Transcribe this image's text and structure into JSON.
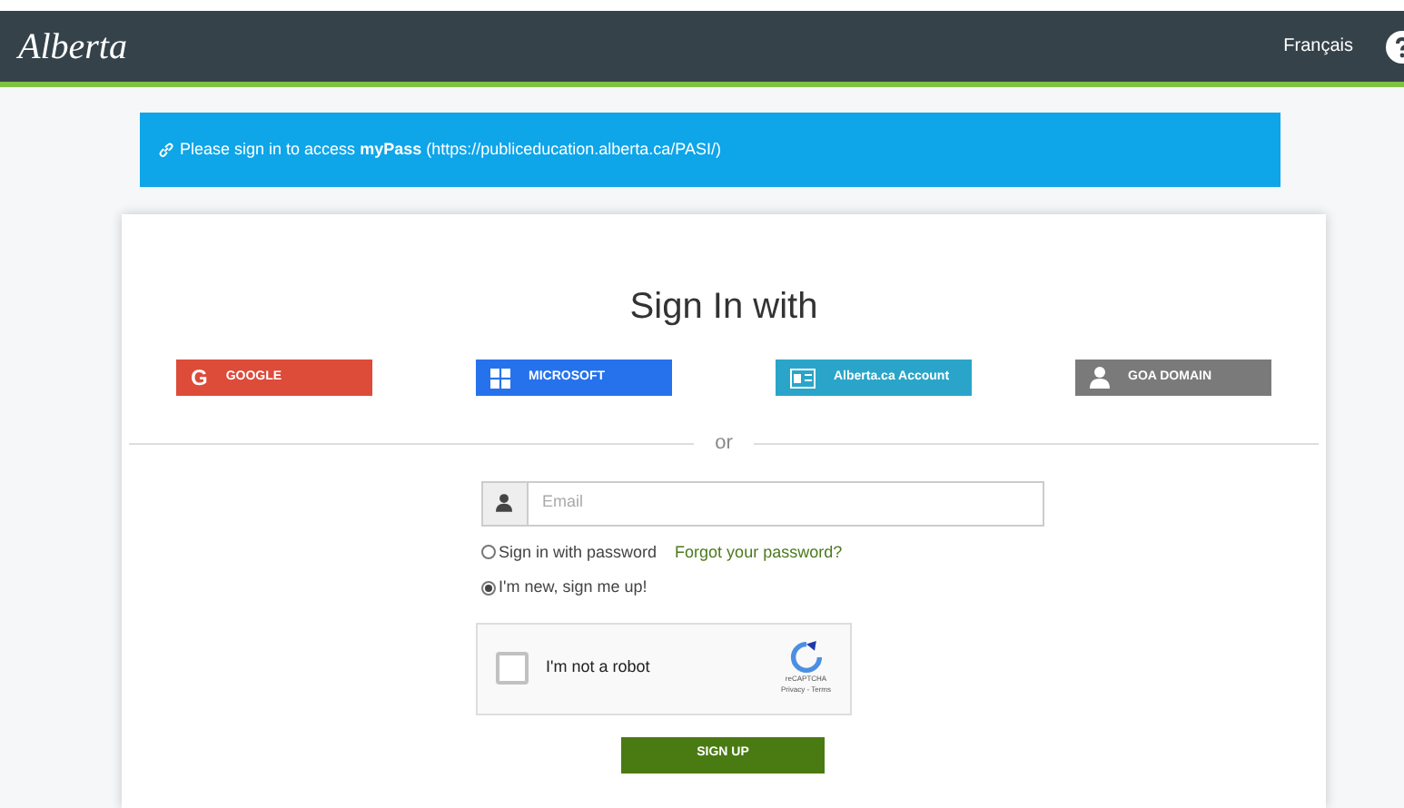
{
  "header": {
    "logo": "Alberta",
    "language_link": "Français"
  },
  "banner": {
    "text": "Please sign in to access **myPass** (https://publiceducation.alberta.ca/PASI/)"
  },
  "card": {
    "title": "Sign In with",
    "providers": [
      {
        "kind": "google",
        "icon": "G",
        "label": "GOOGLE",
        "color": "#dd4b39"
      },
      {
        "kind": "microsoft",
        "label": "MICROSOFT",
        "color": "#2672ec"
      },
      {
        "kind": "alberta",
        "label": "Alberta.ca Account",
        "color": "#2aa5c9"
      },
      {
        "kind": "goa",
        "label": "GOA DOMAIN",
        "color": "#7a7a7a"
      }
    ],
    "divider": "or",
    "email": {
      "placeholder": "Email"
    },
    "options": [
      {
        "label": "Sign in with password",
        "selected": false,
        "link": "Forgot your password?"
      },
      {
        "label": "I'm new, sign me up!",
        "selected": true
      }
    ],
    "captcha": {
      "label": "I'm not a robot",
      "checked": false,
      "brand": "reCAPTCHA",
      "links": "Privacy - Terms"
    },
    "submit": "SIGN UP"
  }
}
